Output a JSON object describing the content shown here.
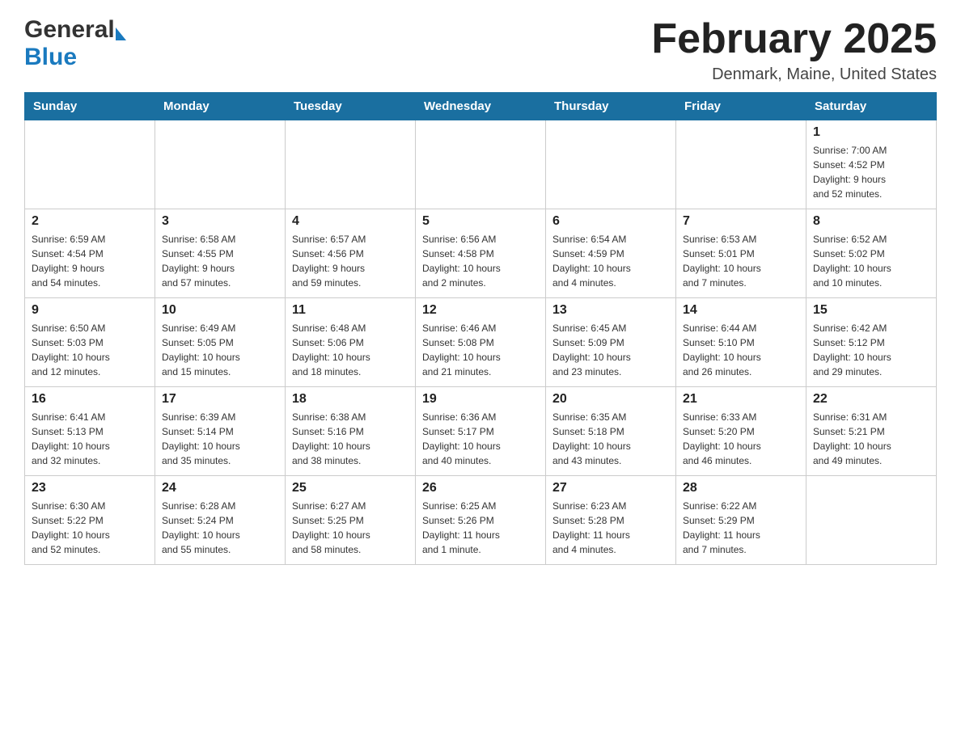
{
  "header": {
    "logo_general": "General",
    "logo_blue": "Blue",
    "month_title": "February 2025",
    "location": "Denmark, Maine, United States"
  },
  "days_of_week": [
    "Sunday",
    "Monday",
    "Tuesday",
    "Wednesday",
    "Thursday",
    "Friday",
    "Saturday"
  ],
  "weeks": [
    [
      {
        "day": "",
        "info": ""
      },
      {
        "day": "",
        "info": ""
      },
      {
        "day": "",
        "info": ""
      },
      {
        "day": "",
        "info": ""
      },
      {
        "day": "",
        "info": ""
      },
      {
        "day": "",
        "info": ""
      },
      {
        "day": "1",
        "info": "Sunrise: 7:00 AM\nSunset: 4:52 PM\nDaylight: 9 hours\nand 52 minutes."
      }
    ],
    [
      {
        "day": "2",
        "info": "Sunrise: 6:59 AM\nSunset: 4:54 PM\nDaylight: 9 hours\nand 54 minutes."
      },
      {
        "day": "3",
        "info": "Sunrise: 6:58 AM\nSunset: 4:55 PM\nDaylight: 9 hours\nand 57 minutes."
      },
      {
        "day": "4",
        "info": "Sunrise: 6:57 AM\nSunset: 4:56 PM\nDaylight: 9 hours\nand 59 minutes."
      },
      {
        "day": "5",
        "info": "Sunrise: 6:56 AM\nSunset: 4:58 PM\nDaylight: 10 hours\nand 2 minutes."
      },
      {
        "day": "6",
        "info": "Sunrise: 6:54 AM\nSunset: 4:59 PM\nDaylight: 10 hours\nand 4 minutes."
      },
      {
        "day": "7",
        "info": "Sunrise: 6:53 AM\nSunset: 5:01 PM\nDaylight: 10 hours\nand 7 minutes."
      },
      {
        "day": "8",
        "info": "Sunrise: 6:52 AM\nSunset: 5:02 PM\nDaylight: 10 hours\nand 10 minutes."
      }
    ],
    [
      {
        "day": "9",
        "info": "Sunrise: 6:50 AM\nSunset: 5:03 PM\nDaylight: 10 hours\nand 12 minutes."
      },
      {
        "day": "10",
        "info": "Sunrise: 6:49 AM\nSunset: 5:05 PM\nDaylight: 10 hours\nand 15 minutes."
      },
      {
        "day": "11",
        "info": "Sunrise: 6:48 AM\nSunset: 5:06 PM\nDaylight: 10 hours\nand 18 minutes."
      },
      {
        "day": "12",
        "info": "Sunrise: 6:46 AM\nSunset: 5:08 PM\nDaylight: 10 hours\nand 21 minutes."
      },
      {
        "day": "13",
        "info": "Sunrise: 6:45 AM\nSunset: 5:09 PM\nDaylight: 10 hours\nand 23 minutes."
      },
      {
        "day": "14",
        "info": "Sunrise: 6:44 AM\nSunset: 5:10 PM\nDaylight: 10 hours\nand 26 minutes."
      },
      {
        "day": "15",
        "info": "Sunrise: 6:42 AM\nSunset: 5:12 PM\nDaylight: 10 hours\nand 29 minutes."
      }
    ],
    [
      {
        "day": "16",
        "info": "Sunrise: 6:41 AM\nSunset: 5:13 PM\nDaylight: 10 hours\nand 32 minutes."
      },
      {
        "day": "17",
        "info": "Sunrise: 6:39 AM\nSunset: 5:14 PM\nDaylight: 10 hours\nand 35 minutes."
      },
      {
        "day": "18",
        "info": "Sunrise: 6:38 AM\nSunset: 5:16 PM\nDaylight: 10 hours\nand 38 minutes."
      },
      {
        "day": "19",
        "info": "Sunrise: 6:36 AM\nSunset: 5:17 PM\nDaylight: 10 hours\nand 40 minutes."
      },
      {
        "day": "20",
        "info": "Sunrise: 6:35 AM\nSunset: 5:18 PM\nDaylight: 10 hours\nand 43 minutes."
      },
      {
        "day": "21",
        "info": "Sunrise: 6:33 AM\nSunset: 5:20 PM\nDaylight: 10 hours\nand 46 minutes."
      },
      {
        "day": "22",
        "info": "Sunrise: 6:31 AM\nSunset: 5:21 PM\nDaylight: 10 hours\nand 49 minutes."
      }
    ],
    [
      {
        "day": "23",
        "info": "Sunrise: 6:30 AM\nSunset: 5:22 PM\nDaylight: 10 hours\nand 52 minutes."
      },
      {
        "day": "24",
        "info": "Sunrise: 6:28 AM\nSunset: 5:24 PM\nDaylight: 10 hours\nand 55 minutes."
      },
      {
        "day": "25",
        "info": "Sunrise: 6:27 AM\nSunset: 5:25 PM\nDaylight: 10 hours\nand 58 minutes."
      },
      {
        "day": "26",
        "info": "Sunrise: 6:25 AM\nSunset: 5:26 PM\nDaylight: 11 hours\nand 1 minute."
      },
      {
        "day": "27",
        "info": "Sunrise: 6:23 AM\nSunset: 5:28 PM\nDaylight: 11 hours\nand 4 minutes."
      },
      {
        "day": "28",
        "info": "Sunrise: 6:22 AM\nSunset: 5:29 PM\nDaylight: 11 hours\nand 7 minutes."
      },
      {
        "day": "",
        "info": ""
      }
    ]
  ]
}
